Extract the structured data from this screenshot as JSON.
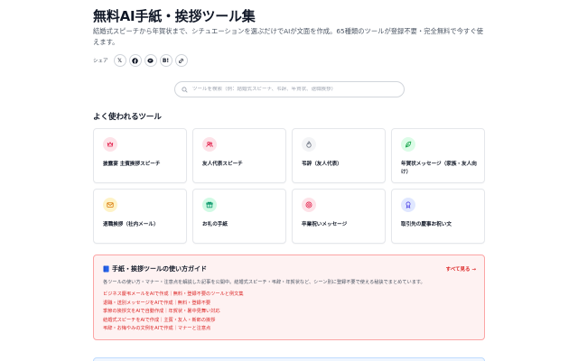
{
  "header": {
    "title": "無料AI手紙・挨拶ツール集",
    "description": "結婚式スピーチから年賀状まで、シチュエーションを選ぶだけでAIが文面を作成。65種類のツールが登録不要・完全無料で今すぐ使えます。"
  },
  "share": {
    "label": "シェア",
    "buttons": [
      {
        "icon": "x-icon",
        "text": "𝕏"
      },
      {
        "icon": "facebook-icon",
        "text": "f"
      },
      {
        "icon": "line-icon",
        "text": ""
      },
      {
        "icon": "hatena-icon",
        "text": "B!"
      },
      {
        "icon": "link-icon",
        "text": ""
      }
    ]
  },
  "search": {
    "placeholder": "ツールを検索（例：結婚式スピーチ、弔辞、年賀状、退職挨拶）"
  },
  "popular": {
    "title": "よく使われるツール",
    "cards": [
      {
        "label": "披露宴 主賓挨拶スピーチ",
        "icon": "crown-icon",
        "bg": "#fde2e8",
        "fg": "#e11d48"
      },
      {
        "label": "友人代表スピーチ",
        "icon": "people-icon",
        "bg": "#fde2e8",
        "fg": "#e11d48"
      },
      {
        "label": "弔辞（友人代表）",
        "icon": "flame-icon",
        "bg": "#f3f4f6",
        "fg": "#6b7280"
      },
      {
        "label": "年賀状メッセージ（家族・友人向け）",
        "icon": "leaf-icon",
        "bg": "#dcfce7",
        "fg": "#16a34a"
      },
      {
        "label": "退職挨拶（社内メール）",
        "icon": "envelope-icon",
        "bg": "#fef3c7",
        "fg": "#d97706"
      },
      {
        "label": "お礼の手紙",
        "icon": "gift-icon",
        "bg": "#d1fae5",
        "fg": "#059669"
      },
      {
        "label": "卒業祝いメッセージ",
        "icon": "target-icon",
        "bg": "#fde2e8",
        "fg": "#e11d48"
      },
      {
        "label": "取引先の慶事お祝い文",
        "icon": "award-icon",
        "bg": "#e0e7ff",
        "fg": "#4f46e5"
      }
    ]
  },
  "guide": {
    "title": "手紙・挨拶ツールの使い方ガイド",
    "more": "すべて見る →",
    "description": "各ツールの使い方・マナー・注意点を解説した記事を公開中。結婚式スピーチ・弔辞・年賀状など、シーン別に登録不要で使える秘訣でまとめています。",
    "links": [
      "ビジネス慶弔メールをAIで作成｜無料・登録不要のツールと例文集",
      "退職・送別メッセージをAIで作成｜無料・登録不要",
      "季節の挨拶文をAIで自動作成｜年賀状・暑中見舞い対応",
      "結婚式スピーチをAIで作成｜主賓・友人・新郎の挨拶",
      "弔辞・お悔やみの文例をAIで作成｜マナーと注意点"
    ]
  },
  "colors": {
    "accent": "#dc2626",
    "guide_bg": "#fef2f2",
    "guide_border": "#fca5a5"
  }
}
